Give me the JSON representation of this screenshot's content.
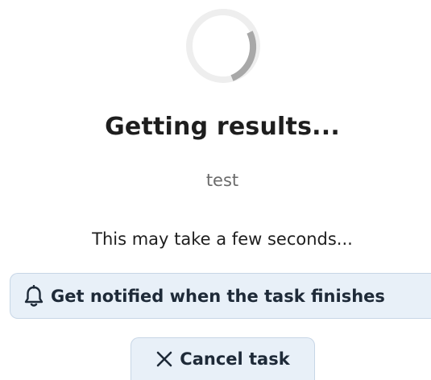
{
  "status": {
    "title": "Getting results...",
    "subtitle": "test",
    "info": "This may take a few seconds..."
  },
  "actions": {
    "notify_label": "Get notified when the task finishes",
    "cancel_label": "Cancel task"
  },
  "icons": {
    "notify": "bell-icon",
    "cancel": "close-icon",
    "loading": "loading-spinner"
  },
  "colors": {
    "button_bg": "#e8f0f8",
    "button_border": "#c7d6e6",
    "spinner_track": "#eeeeee",
    "spinner_arc": "#a8a8a8"
  }
}
